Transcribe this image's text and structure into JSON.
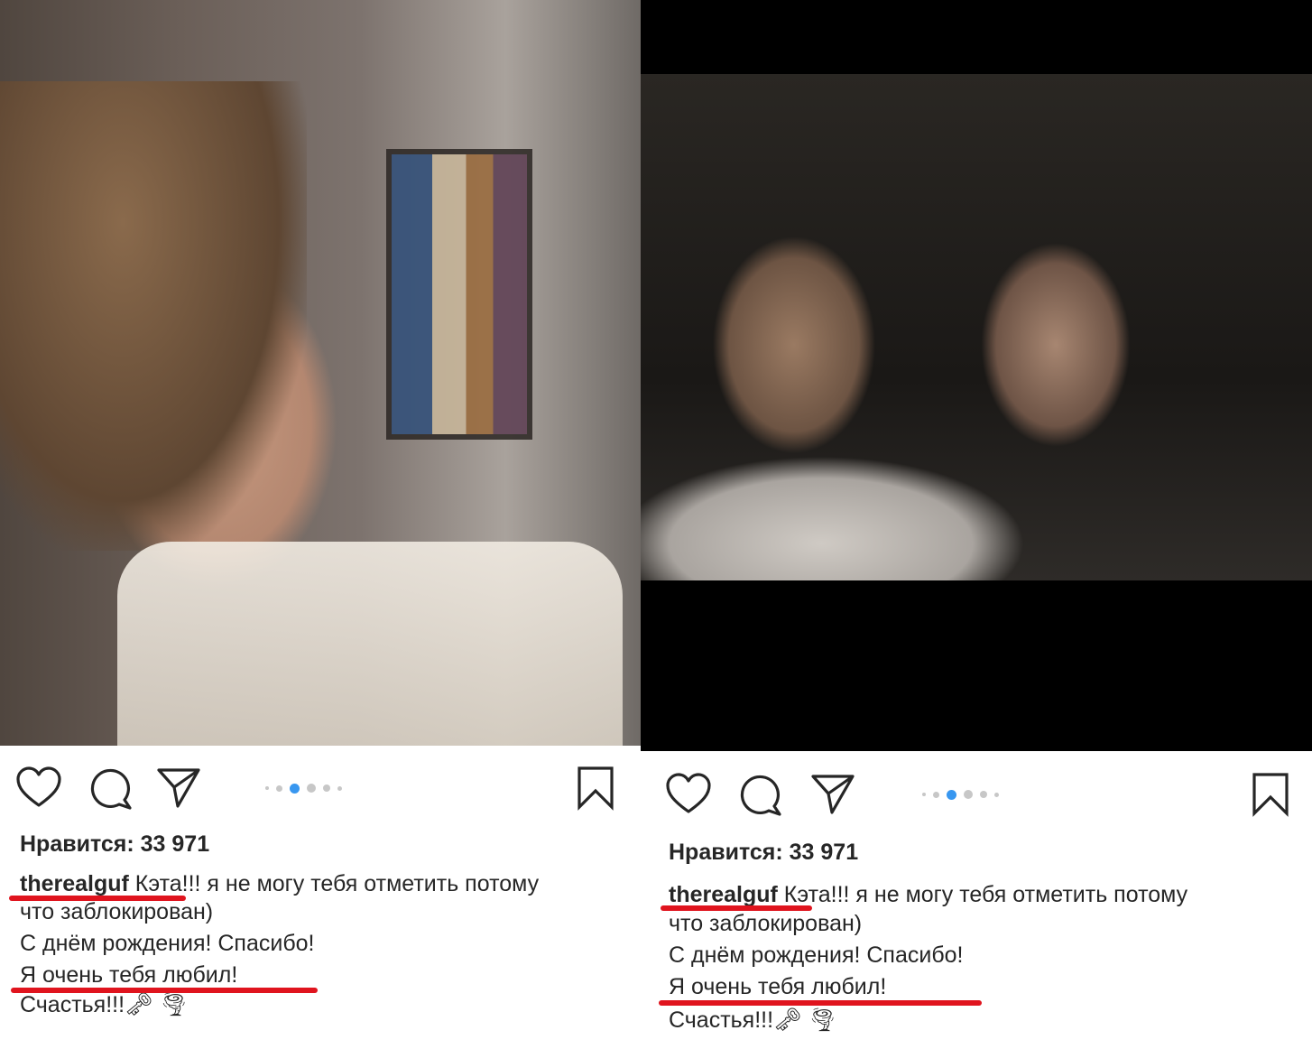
{
  "posts": [
    {
      "likes": "Нравится: 33 971",
      "username": "therealguf",
      "caption_line1": " Кэта!!! я не могу тебя отметить потому",
      "caption_line2": "что заблокирован)",
      "caption_line3": "С днём рождения! Спасибо!",
      "caption_line4": "Я очень тебя любил!",
      "caption_line5": "Счастья!!!🗝 🌪",
      "carousel": {
        "count": 6,
        "active": 2
      },
      "icons": [
        "heart-icon",
        "comment-icon",
        "share-icon",
        "bookmark-icon"
      ]
    },
    {
      "likes": "Нравится: 33 971",
      "username": "therealguf",
      "caption_line1": " Кэта!!! я не могу тебя отметить потому",
      "caption_line2": "что заблокирован)",
      "caption_line3": "С днём рождения! Спасибо!",
      "caption_line4": "Я очень тебя любил!",
      "caption_line5": "Счастья!!!🗝 🌪",
      "carousel": {
        "count": 6,
        "active": 2
      },
      "icons": [
        "heart-icon",
        "comment-icon",
        "share-icon",
        "bookmark-icon"
      ]
    }
  ],
  "colors": {
    "text": "#262626",
    "active_dot": "#3897f0",
    "inactive_dot": "#c7c7c7",
    "annotation": "#e0141e"
  }
}
